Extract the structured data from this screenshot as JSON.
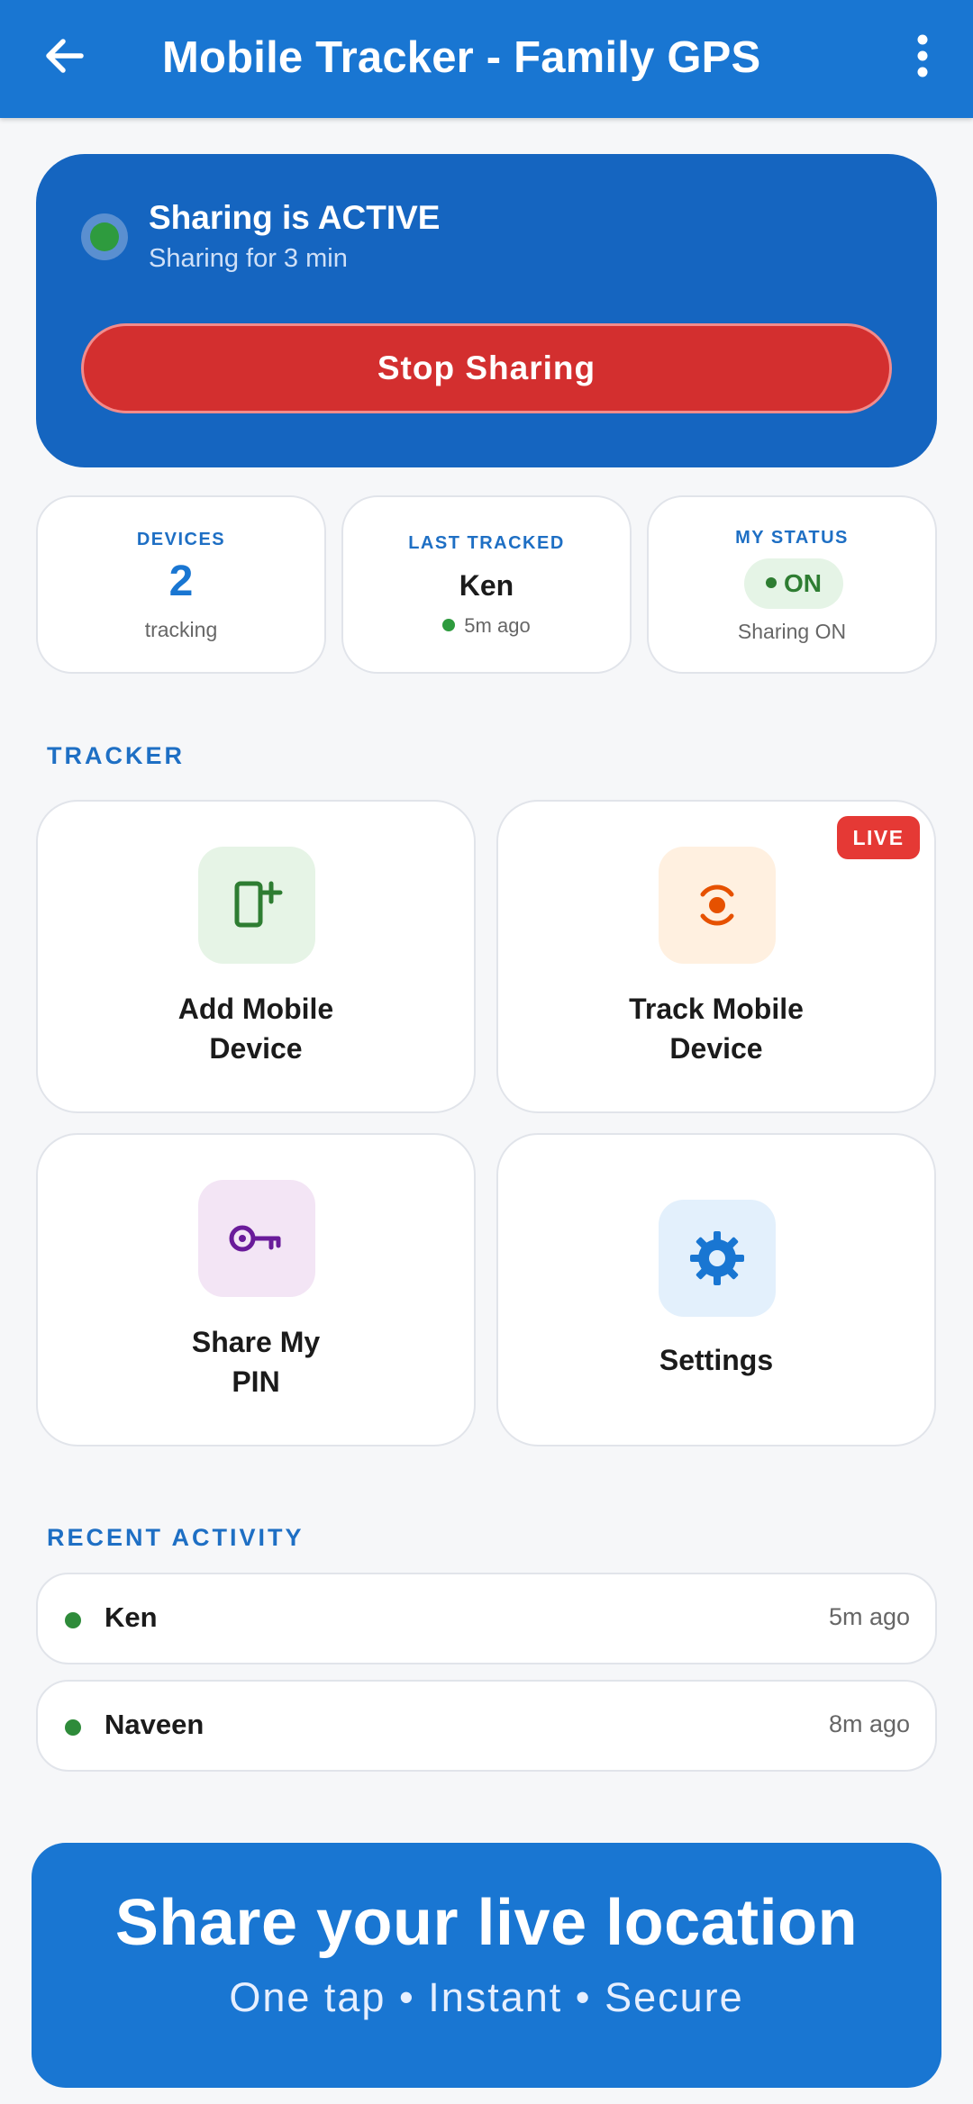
{
  "app_bar": {
    "title": "Mobile Tracker - Family GPS",
    "back_icon": "arrow-left-icon",
    "more_icon": "more-vertical-icon",
    "color": "#1976d2"
  },
  "sharing_card": {
    "status_title": "Sharing is ACTIVE",
    "status_subtitle": "Sharing for 3 min",
    "stop_button_label": "Stop Sharing",
    "card_color": "#1565c0",
    "button_color": "#d32f2f"
  },
  "stats": {
    "devices": {
      "label": "DEVICES",
      "value": "2",
      "sub": "tracking"
    },
    "last_tracked": {
      "label": "LAST TRACKED",
      "name": "Ken",
      "time": "5m ago"
    },
    "my_status": {
      "label": "MY STATUS",
      "pill": "ON",
      "sub": "Sharing ON"
    }
  },
  "tracker": {
    "section_title": "TRACKER",
    "tiles": [
      {
        "label_line1": "Add Mobile",
        "label_line2": "Device",
        "icon": "add-device-icon",
        "icon_bg": "#e6f4e6",
        "icon_color": "#2e7d32"
      },
      {
        "label_line1": "Track Mobile",
        "label_line2": "Device",
        "icon": "target-tracking-icon",
        "icon_bg": "#fff0e0",
        "icon_color": "#e65100",
        "badge": "LIVE"
      },
      {
        "label_line1": "Share My",
        "label_line2": "PIN",
        "icon": "key-icon",
        "icon_bg": "#f3e5f5",
        "icon_color": "#6a1b9a"
      },
      {
        "label": "Settings",
        "icon": "gear-icon",
        "icon_bg": "#e3f0fc",
        "icon_color": "#1976d2"
      }
    ]
  },
  "recent_activity": {
    "section_title": "RECENT ACTIVITY",
    "items": [
      {
        "name": "Ken",
        "time": "5m ago"
      },
      {
        "name": "Naveen",
        "time": "8m ago"
      }
    ]
  },
  "banner": {
    "title": "Share your live location",
    "subtitle": "One tap  •  Instant  •  Secure"
  }
}
